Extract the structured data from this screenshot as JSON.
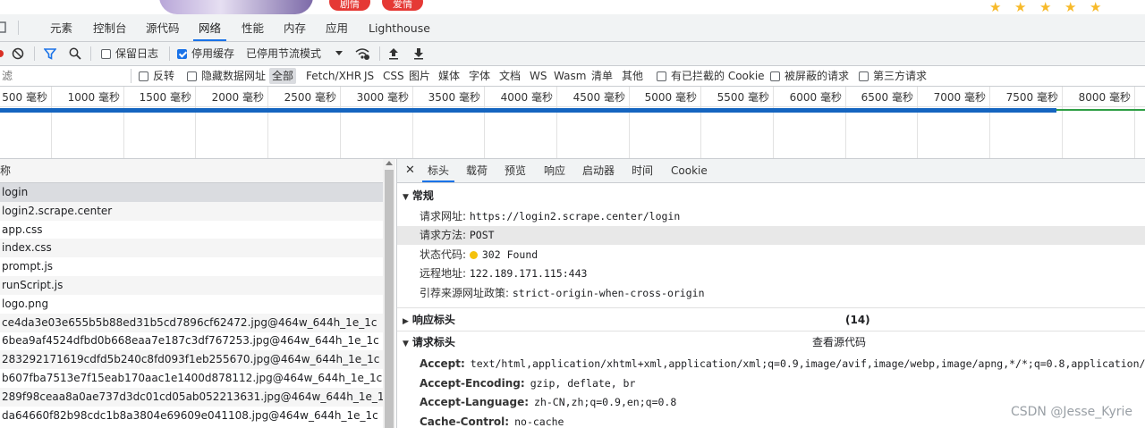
{
  "page_strip": {
    "buttons": [
      "剧情",
      "爱情"
    ],
    "rating_stars": 5
  },
  "devtools_tabs": [
    {
      "label": "元素"
    },
    {
      "label": "控制台"
    },
    {
      "label": "源代码"
    },
    {
      "label": "网络"
    },
    {
      "label": "性能"
    },
    {
      "label": "内存"
    },
    {
      "label": "应用"
    },
    {
      "label": "Lighthouse"
    }
  ],
  "toolbar": {
    "preserve_log": "保留日志",
    "disable_cache": "停用缓存",
    "throttling": "已停用节流模式"
  },
  "filter": {
    "placeholder": "滤",
    "invert": "反转",
    "hide_data_urls": "隐藏数据网址",
    "types": [
      "全部",
      "Fetch/XHR",
      "JS",
      "CSS",
      "图片",
      "媒体",
      "字体",
      "文档",
      "WS",
      "Wasm",
      "清单",
      "其他"
    ],
    "blocked_cookies": "有已拦截的 Cookie",
    "blocked_requests": "被屏蔽的请求",
    "third_party": "第三方请求"
  },
  "timeline": {
    "ticks": [
      "500 毫秒",
      "1000 毫秒",
      "1500 毫秒",
      "2000 毫秒",
      "2500 毫秒",
      "3000 毫秒",
      "3500 毫秒",
      "4000 毫秒",
      "4500 毫秒",
      "5000 毫秒",
      "5500 毫秒",
      "6000 毫秒",
      "6500 毫秒",
      "7000 毫秒",
      "7500 毫秒",
      "8000 毫秒"
    ]
  },
  "request_list": {
    "header": "称",
    "rows": [
      "login",
      "login2.scrape.center",
      "app.css",
      "index.css",
      "prompt.js",
      "runScript.js",
      "logo.png",
      "ce4da3e03e655b5b88ed31b5cd7896cf62472.jpg@464w_644h_1e_1c",
      "6bea9af4524dfbd0b668eaa7e187c3df767253.jpg@464w_644h_1e_1c",
      "283292171619cdfd5b240c8fd093f1eb255670.jpg@464w_644h_1e_1c",
      "b607fba7513e7f15eab170aac1e1400d878112.jpg@464w_644h_1e_1c",
      "289f98ceaa8a0ae737d3dc01cd05ab052213631.jpg@464w_644h_1e_1c",
      "da64660f82b98cdc1b8a3804e69609e041108.jpg@464w_644h_1e_1c"
    ]
  },
  "detail_tabs": [
    "标头",
    "载荷",
    "预览",
    "响应",
    "启动器",
    "时间",
    "Cookie"
  ],
  "general": {
    "title": "常规",
    "request_url_k": "请求网址:",
    "request_url_v": "https://login2.scrape.center/login",
    "method_k": "请求方法:",
    "method_v": "POST",
    "status_k": "状态代码:",
    "status_v": "302 Found",
    "remote_k": "远程地址:",
    "remote_v": "122.189.171.115:443",
    "referrer_k": "引荐来源网址政策:",
    "referrer_v": "strict-origin-when-cross-origin"
  },
  "response_headers": {
    "title": "响应标头",
    "count": "(14)"
  },
  "request_headers": {
    "title": "请求标头",
    "view_source": "查看源代码",
    "items": [
      {
        "k": "Accept:",
        "v": "text/html,application/xhtml+xml,application/xml;q=0.9,image/avif,image/webp,image/apng,*/*;q=0.8,application/signed-e"
      },
      {
        "k": "Accept-Encoding:",
        "v": "gzip, deflate, br"
      },
      {
        "k": "Accept-Language:",
        "v": "zh-CN,zh;q=0.9,en;q=0.8"
      },
      {
        "k": "Cache-Control:",
        "v": "no-cache"
      }
    ]
  },
  "watermark": "CSDN @Jesse_Kyrie",
  "colors": {
    "accent": "#1a73e8",
    "bar_blue": "#1565c0",
    "bar_green": "#2e9e44",
    "badge_red": "#e53935",
    "star": "#f7ba2a",
    "status_dot": "#f4c20d"
  }
}
